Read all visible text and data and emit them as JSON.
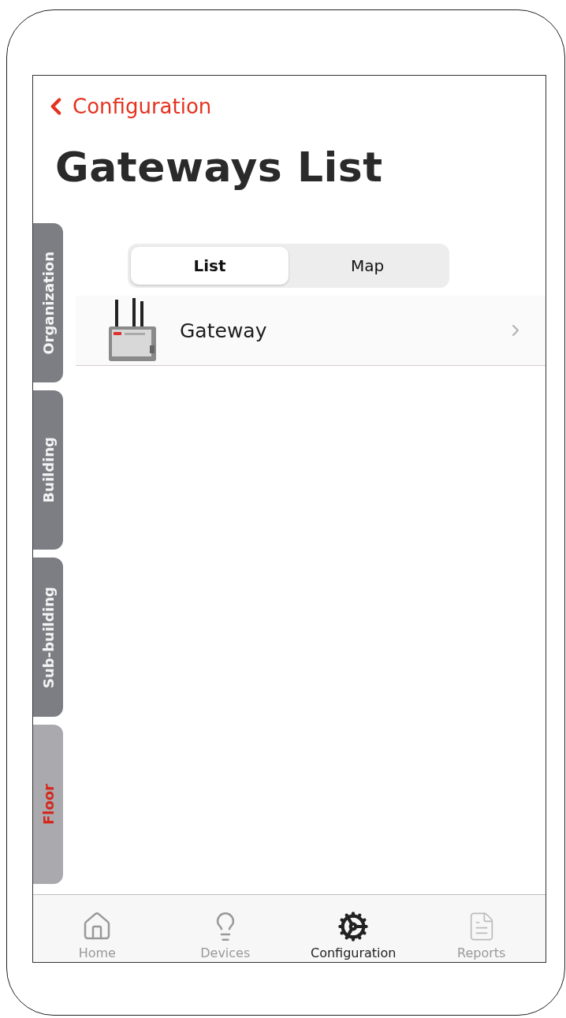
{
  "header": {
    "back_label": "Configuration",
    "title": "Gateways List"
  },
  "side_tabs": [
    {
      "label": "Organization",
      "selected": false
    },
    {
      "label": "Building",
      "selected": false
    },
    {
      "label": "Sub-building",
      "selected": false
    },
    {
      "label": "Floor",
      "selected": true
    }
  ],
  "segments": [
    {
      "label": "List",
      "selected": true
    },
    {
      "label": "Map",
      "selected": false
    }
  ],
  "gateways": [
    {
      "name": "Gateway",
      "kind": "picture"
    }
  ],
  "tab_bar": [
    {
      "kind": "home",
      "label": "Home",
      "selected": false
    },
    {
      "kind": "devices",
      "label": "Devices",
      "selected": false
    },
    {
      "kind": "configuration",
      "label": "Configuration",
      "selected": true
    },
    {
      "kind": "reports",
      "label": "Reports",
      "selected": false
    }
  ]
}
